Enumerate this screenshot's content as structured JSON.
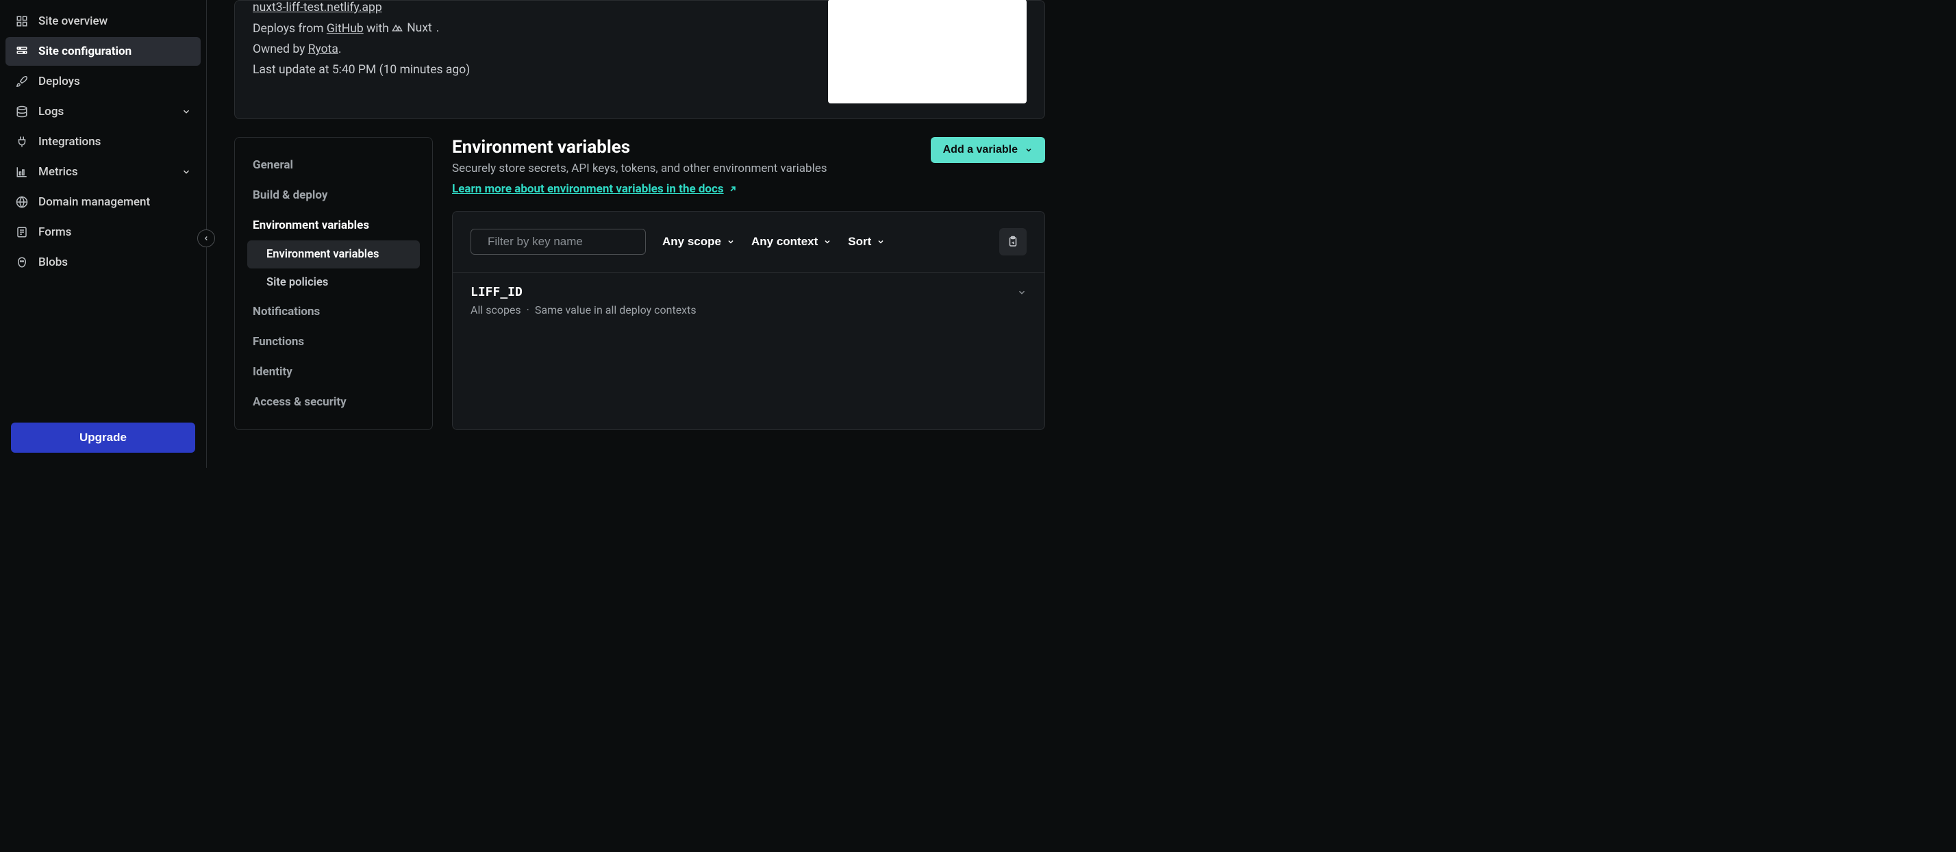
{
  "sidebar": {
    "items": [
      {
        "id": "overview",
        "label": "Site overview"
      },
      {
        "id": "configuration",
        "label": "Site configuration"
      },
      {
        "id": "deploys",
        "label": "Deploys"
      },
      {
        "id": "logs",
        "label": "Logs"
      },
      {
        "id": "integrations",
        "label": "Integrations"
      },
      {
        "id": "metrics",
        "label": "Metrics"
      },
      {
        "id": "domain",
        "label": "Domain management"
      },
      {
        "id": "forms",
        "label": "Forms"
      },
      {
        "id": "blobs",
        "label": "Blobs"
      }
    ],
    "upgrade_label": "Upgrade"
  },
  "site_card": {
    "url": "nuxt3-liff-test.netlify.app",
    "deploys_prefix": "Deploys from ",
    "deploys_source": "GitHub",
    "deploys_with": " with ",
    "framework": "Nuxt",
    "owned_prefix": "Owned by ",
    "owner": "Ryota",
    "last_update": "Last update at 5:40 PM (10 minutes ago)"
  },
  "config_nav": {
    "items": [
      {
        "id": "general",
        "label": "General"
      },
      {
        "id": "build",
        "label": "Build & deploy"
      },
      {
        "id": "env",
        "label": "Environment variables",
        "subs": [
          {
            "id": "env-vars",
            "label": "Environment variables"
          },
          {
            "id": "site-policies",
            "label": "Site policies"
          }
        ]
      },
      {
        "id": "notifications",
        "label": "Notifications"
      },
      {
        "id": "functions",
        "label": "Functions"
      },
      {
        "id": "identity",
        "label": "Identity"
      },
      {
        "id": "access",
        "label": "Access & security"
      }
    ]
  },
  "env": {
    "heading": "Environment variables",
    "subheading": "Securely store secrets, API keys, tokens, and other environment variables",
    "docs_link": "Learn more about environment variables in the docs",
    "add_button": "Add a variable",
    "filter_placeholder": "Filter by key name",
    "scope_label": "Any scope",
    "context_label": "Any context",
    "sort_label": "Sort",
    "variables": [
      {
        "key": "LIFF_ID",
        "scope": "All scopes",
        "context": "Same value in all deploy contexts"
      }
    ]
  }
}
